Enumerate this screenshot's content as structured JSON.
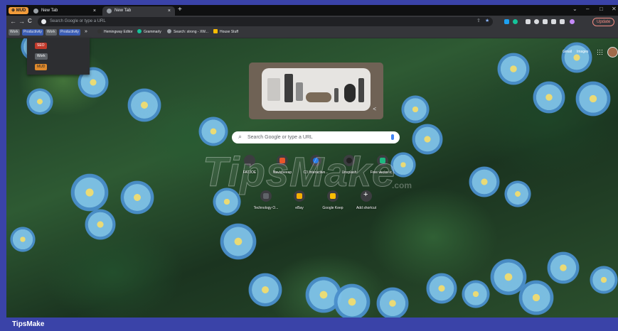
{
  "tabs": {
    "group_label": "MUD",
    "items": [
      {
        "label": "New Tab",
        "close": "×"
      },
      {
        "label": "New Tab",
        "close": "×"
      }
    ],
    "new_tab": "+"
  },
  "window_controls": {
    "chevron": "⌄",
    "minimize": "–",
    "maximize": "□",
    "close": "✕"
  },
  "toolbar": {
    "back": "←",
    "forward": "→",
    "reload": "C",
    "omnibox_placeholder": "Search Google or type a URL",
    "update_label": "Update"
  },
  "bookmarks": {
    "chips": [
      {
        "label": "Work",
        "color": "#5f6368"
      },
      {
        "label": "Productivity",
        "color": "#3b5db5"
      },
      {
        "label": "Work",
        "color": "#5f6368"
      },
      {
        "label": "Productivity",
        "color": "#3b5db5"
      }
    ],
    "more": "»",
    "items": [
      {
        "label": "Hemingway Editor",
        "icon_color": "#333"
      },
      {
        "label": "Grammarly",
        "icon_color": "#15c39a"
      },
      {
        "label": "Search: strong - XW...",
        "icon_color": "#9aa0a6"
      },
      {
        "label": "House Stuff",
        "icon_color": "#fbbc04"
      }
    ]
  },
  "tab_group_menu": {
    "items": [
      {
        "label": "SEO",
        "color": "#c0392b"
      },
      {
        "label": "Work",
        "color": "#5f6368"
      },
      {
        "label": "MUD",
        "color": "#e08a2c"
      }
    ]
  },
  "ntp": {
    "gmail": "Gmail",
    "images": "Images",
    "search_placeholder": "Search Google or type a URL",
    "share_glyph": "<",
    "shortcuts": [
      {
        "label": "FATJOE",
        "color": "#3c3d40"
      },
      {
        "label": "Navixbeeap",
        "color": "#e8552b"
      },
      {
        "label": "C3 Interactive...",
        "color": "#1a73e8"
      },
      {
        "label": "Unsplash",
        "color": "#222222"
      },
      {
        "label": "Free vector ic...",
        "color": "#1eb980"
      },
      {
        "label": "Technology O...",
        "color": "#5f6368"
      },
      {
        "label": "eBay",
        "color": "#f5af02"
      },
      {
        "label": "Google Keep",
        "color": "#fbbc04"
      },
      {
        "label": "Add shortcut",
        "color": "#5f6368"
      }
    ],
    "add_glyph": "+"
  },
  "watermark": {
    "brand": "TipsMake",
    "domain": ".com"
  },
  "footer": {
    "brand": "TipsMake"
  }
}
